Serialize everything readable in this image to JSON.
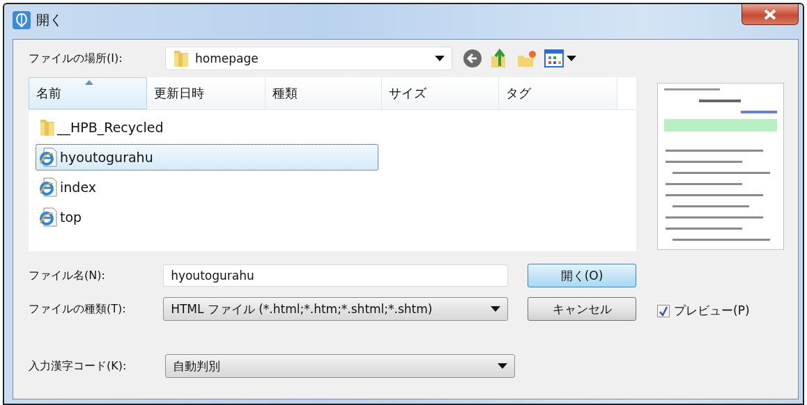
{
  "window": {
    "title": "開く"
  },
  "location": {
    "label": "ファイルの場所(I):",
    "value": "homepage"
  },
  "file_list": {
    "columns": [
      {
        "label": "名前",
        "sorted": true
      },
      {
        "label": "更新日時",
        "sorted": false
      },
      {
        "label": "種類",
        "sorted": false
      },
      {
        "label": "サイズ",
        "sorted": false
      },
      {
        "label": "タグ",
        "sorted": false
      }
    ],
    "items": [
      {
        "name": "__HPB_Recycled",
        "kind": "folder",
        "selected": false
      },
      {
        "name": "hyoutogurahu",
        "kind": "html",
        "selected": true
      },
      {
        "name": "index",
        "kind": "html",
        "selected": false
      },
      {
        "name": "top",
        "kind": "html",
        "selected": false
      }
    ]
  },
  "file_name": {
    "label": "ファイル名(N):",
    "value": "hyoutogurahu"
  },
  "file_type": {
    "label": "ファイルの種類(T):",
    "value": "HTML ファイル (*.html;*.htm;*.shtml;*.shtm)"
  },
  "encoding": {
    "label": "入力漢字コード(K):",
    "value": "自動判別"
  },
  "buttons": [
    {
      "label": "開く(O)",
      "default": true
    },
    {
      "label": "キャンセル",
      "default": false
    }
  ],
  "preview_toggle": {
    "label": "プレビュー(P)",
    "checked": true
  }
}
